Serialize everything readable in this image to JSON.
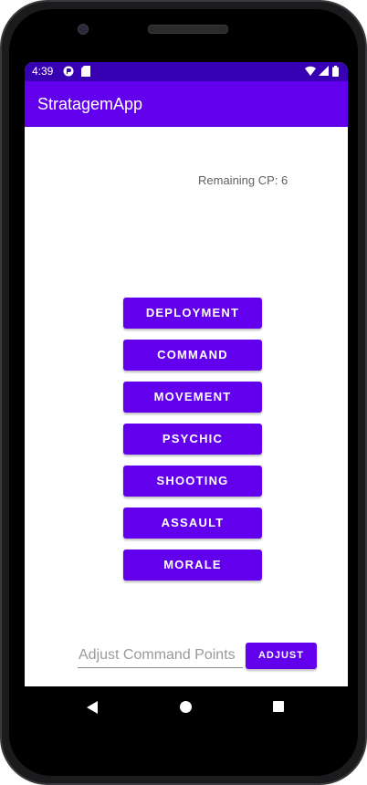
{
  "status_bar": {
    "time": "4:39",
    "left_icons": [
      "app-notification-icon",
      "sd-card-icon"
    ],
    "right_icons": [
      "wifi-icon",
      "signal-icon",
      "battery-icon"
    ]
  },
  "app_bar": {
    "title": "StratagemApp"
  },
  "main": {
    "remaining_cp": "Remaining CP: 6",
    "phase_buttons": [
      {
        "label": "DEPLOYMENT"
      },
      {
        "label": "COMMAND"
      },
      {
        "label": "MOVEMENT"
      },
      {
        "label": "PSYCHIC"
      },
      {
        "label": "SHOOTING"
      },
      {
        "label": "ASSAULT"
      },
      {
        "label": "MORALE"
      }
    ]
  },
  "adjust": {
    "placeholder": "Adjust Command Points",
    "value": "",
    "button_label": "ADJUST"
  },
  "nav_bar": {
    "icons": [
      "back-icon",
      "home-icon",
      "recents-icon"
    ]
  },
  "colors": {
    "primary": "#6200ee",
    "primary_dark": "#3700b3"
  }
}
